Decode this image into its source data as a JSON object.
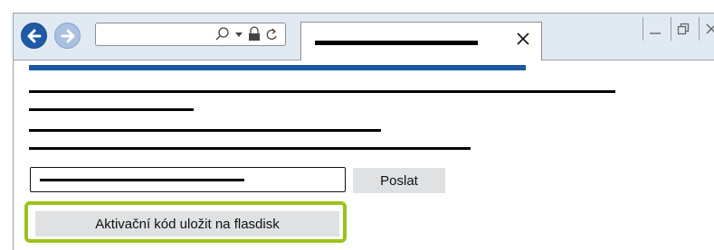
{
  "browser": {
    "nav": {
      "back_icon": "arrow-left-icon",
      "forward_icon": "arrow-right-icon"
    },
    "address_bar": {
      "icons": [
        "search-icon",
        "dropdown-icon",
        "lock-icon",
        "refresh-icon"
      ]
    },
    "tab": {
      "close_icon": "close-icon"
    },
    "window_controls": [
      "minimize-icon",
      "restore-icon",
      "close-icon"
    ]
  },
  "page": {
    "send_button_label": "Poslat",
    "save_button_label": "Aktivační kód uložit na flasdisk"
  },
  "colors": {
    "heading_bar": "#1b58a3",
    "highlight": "#9cc21a",
    "toolbar": "#e1e9f2"
  }
}
